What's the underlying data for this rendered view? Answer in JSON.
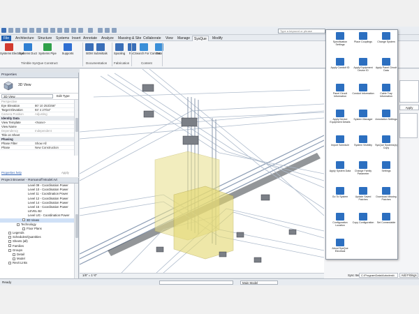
{
  "quick_access": {
    "search_placeholder": "Type a keyword or phrase"
  },
  "tabs": [
    "File",
    "Architecture",
    "Structure",
    "Systems",
    "Insert",
    "Annotate",
    "Analyze",
    "Massing & Site",
    "Collaborate",
    "View",
    "Manage",
    "SysQue",
    "Modify"
  ],
  "active_tab": "SysQue",
  "ribbon": {
    "tools": [
      {
        "label": "Systems Electrical",
        "color": "#d23b2f"
      },
      {
        "label": "Systems Duct",
        "color": "#2f7fd2"
      },
      {
        "label": "Systems Pipe",
        "color": "#2fa04a"
      },
      {
        "label": "Supports",
        "color": "#2f6fd2"
      },
      {
        "label": "BOM",
        "color": "#3a6fb8"
      },
      {
        "label": "Submittals",
        "color": "#3a6fb8"
      },
      {
        "label": "Spooling",
        "color": "#3a6fb8"
      },
      {
        "label": "FAC",
        "color": "#3a6fb8"
      },
      {
        "label": "Search For Content",
        "color": "#3a8fd8"
      },
      {
        "label": "Data",
        "color": "#3a8fd8"
      }
    ],
    "groups": [
      "Trimble SysQue Construct",
      "Documentation",
      "Fabrication",
      "Content"
    ]
  },
  "properties": {
    "title": "Properties",
    "type": "3D View",
    "selector": "3D View",
    "edit_type": "Edit Type",
    "rows": [
      {
        "k": "Perspective",
        "v": "",
        "kind": "gray"
      },
      {
        "k": "Eye Elevation",
        "v": "80' 10 253/256\"",
        "kind": ""
      },
      {
        "k": "Target Elevation",
        "v": "93' 4 27/64\"",
        "kind": ""
      },
      {
        "k": "Camera Position",
        "v": "Adjusting",
        "kind": "gray"
      },
      {
        "k": "Identity Data",
        "v": "",
        "kind": "sec"
      },
      {
        "k": "View Template",
        "v": "<None>",
        "kind": ""
      },
      {
        "k": "View Name",
        "v": "",
        "kind": ""
      },
      {
        "k": "Dependency",
        "v": "Independent",
        "kind": "gray"
      },
      {
        "k": "Title on Sheet",
        "v": "",
        "kind": ""
      },
      {
        "k": "Phasing",
        "v": "",
        "kind": "sec"
      },
      {
        "k": "Phase Filter",
        "v": "Show All",
        "kind": ""
      },
      {
        "k": "Phase",
        "v": "New Construction",
        "kind": ""
      }
    ],
    "help": "Properties help",
    "apply": "Apply"
  },
  "browser": {
    "title": "Project Browser - Romanoff Model.rvt",
    "items": [
      {
        "t": "Level 09 - Coordination Power",
        "indent": 40
      },
      {
        "t": "Level 10 - Coordination Power",
        "indent": 40
      },
      {
        "t": "Level 11 - Coordination Power",
        "indent": 40
      },
      {
        "t": "Level 12 - Coordination Power",
        "indent": 40
      },
      {
        "t": "Level 14 - Coordination Power",
        "indent": 40
      },
      {
        "t": "Level 15 - Coordination Power",
        "indent": 40
      },
      {
        "t": "LEVEL B2",
        "indent": 40
      },
      {
        "t": "Level UG - Coordination Power",
        "indent": 40
      },
      {
        "t": "3D Views",
        "indent": 32
      },
      {
        "t": "Technology",
        "indent": 24
      },
      {
        "t": "Floor Plans",
        "indent": 32
      },
      {
        "t": "Legends",
        "indent": 12
      },
      {
        "t": "Schedules/Quantities",
        "indent": 12
      },
      {
        "t": "Sheets (all)",
        "indent": 12
      },
      {
        "t": "Families",
        "indent": 12
      },
      {
        "t": "Groups",
        "indent": 12
      },
      {
        "t": "Detail",
        "indent": 18
      },
      {
        "t": "Model",
        "indent": 18
      },
      {
        "t": "Revit Links",
        "indent": 12
      }
    ]
  },
  "view_scale": "1/8\" = 1'-0\"",
  "popup": {
    "items": [
      {
        "label": "Specification Settings",
        "color": "#2c6fc0"
      },
      {
        "label": "Place Couplings",
        "color": "#2c6fc0"
      },
      {
        "label": "Change System",
        "color": "#2c6fc0"
      },
      {
        "label": "Apply Conduit ID",
        "color": "#2c6fc0"
      },
      {
        "label": "Apply Equipment Device ID",
        "color": "#2c6fc0"
      },
      {
        "label": "Apply Panel Circuit Data",
        "color": "#2c6fc0"
      },
      {
        "label": "Panel Circuit Information",
        "color": "#2c6fc0"
      },
      {
        "label": "Conduit Information",
        "color": "#2c6fc0"
      },
      {
        "label": "Cable Tray Information",
        "color": "#2c6fc0"
      },
      {
        "label": "Apply Device Equipment Details",
        "color": "#2c6fc0"
      },
      {
        "label": "System Manager",
        "color": "#2c6fc0"
      },
      {
        "label": "Annotation Settings",
        "color": "#2c6fc0"
      },
      {
        "label": "Import Schedule",
        "color": "#2c6fc0"
      },
      {
        "label": "System Visibility",
        "color": "#2c6fc0"
      },
      {
        "label": "SysQue Systems(s) Copy",
        "color": "#2c6fc0"
      },
      {
        "label": "Apply System Data",
        "color": "#2c6fc0"
      },
      {
        "label": "Change Family Parameter",
        "color": "#2c6fc0"
      },
      {
        "label": "Settings",
        "color": "#2c6fc0"
      },
      {
        "label": "Go To System",
        "color": "#2c6fc0"
      },
      {
        "label": "Update Saved Patches",
        "color": "#2c6fc0"
      },
      {
        "label": "Download Missing Patches",
        "color": "#2c6fc0"
      },
      {
        "label": "Configuration Location",
        "color": "#2c6fc0"
      },
      {
        "label": "Copy Configuration",
        "color": "#2c6fc0"
      },
      {
        "label": "Set Connectable",
        "color": "#2c6fc0"
      },
      {
        "label": "About SysQue Electrical",
        "color": "#2c6fc0"
      }
    ]
  },
  "right_panel": {
    "apply": "Apply",
    "path": "C:\\ProgramData\\Autodesk\\",
    "sync_label": "Sync Item:",
    "add_fittings": "Add Fittings"
  },
  "status": {
    "ready": "Ready",
    "model": "Main Model"
  }
}
